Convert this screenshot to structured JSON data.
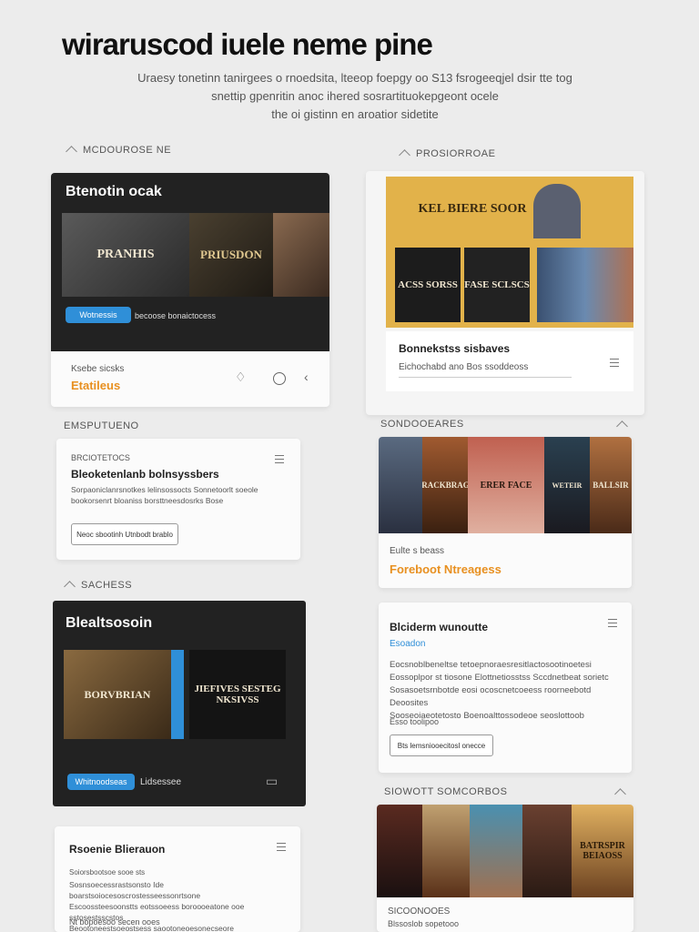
{
  "header": {
    "title": "wiraruscod iuele neme pine",
    "subtitle_lines": [
      "Uraesy tonetinn tanirgees o rnoedsita, lteeop foepgy oo S13 fsrogeeqjel dsir tte tog",
      "snettip gpenritin anoc ihered sosrartituokepgeont ocele",
      "the oi gistinn en aroatior sidetite"
    ]
  },
  "colors": {
    "accent_blue": "#2f8fd8",
    "accent_orange": "#e89020",
    "dark_panel": "#222222",
    "gold_banner": "#e2b24a"
  },
  "sections": {
    "left_1": "MCDOUROSE NE",
    "right_1": "PROSIORROAE",
    "left_2": "EMSPUTUENO",
    "right_2": "SONDOOEARES",
    "left_3": "SACHESS",
    "right_3": "SIOWOTT SOMCORBOS"
  },
  "card_a": {
    "title": "Btenotin ocak",
    "posters": [
      "PRANHIS",
      "PRIUSDON",
      ""
    ],
    "button": "Wotnessis",
    "caption": "becoose bonaictocess",
    "small_label": "Ksebe sicsks",
    "link": "Etatileus",
    "icons": [
      "bell-icon",
      "circle-icon",
      "send-icon"
    ]
  },
  "card_b": {
    "banner_text": "KEL BIERE SOOR",
    "posters": [
      "ACSS SORSS",
      "FASE SCLSCS",
      ""
    ],
    "title": "Bonnekstss sisbaves",
    "meta": "Eichochabd ano  Bos ssoddeoss"
  },
  "card_c": {
    "kicker": "BRCIOTETOCS",
    "title": "Bleoketenlanb bolnsyssbers",
    "desc": "Sorpaoniclanrsnotkes lelinsossocts Sonnetoorlt soeole bookorsenrt bloaniss borsttneesdosrks Bose",
    "button": "Neoc sbootinh Utnbodt brablo"
  },
  "card_d": {
    "posters": [
      "",
      "BRACKBRAGS",
      "ERER FACE",
      "WETEIR",
      "BALLSIR"
    ],
    "small_label": "Eulte s beass",
    "link": "Foreboot Ntreagess"
  },
  "card_e": {
    "title": "Blealtsosoin",
    "posters": [
      "BORVBRIAN",
      "JIEFIVES SESTEG NKSIVSS"
    ],
    "button": "Whitnoodseas",
    "caption": "Lidsessee"
  },
  "card_f": {
    "title": "Blciderm wunoutte",
    "tag": "Esoadon",
    "body_lines": [
      "Eocsnoblbeneltse tetoepnoraesresitlactosootinoetesi",
      "Eossoplpor st tiosone Elottnetiosstss Sccdnetbeat sorietc",
      "Sosasoetsrnbotde eosi ocoscnetcoeess roorneebotd Deoosites",
      "Sooseoiaeotetosto Boenoalttossodeoe seoslottoob"
    ],
    "meta": "Esso toolipoo",
    "button": "Bts lemsniooecitosl onecce"
  },
  "card_g": {
    "title": "Rsoenie Blierauon",
    "line1": "Soiorsbootsoe sooe sts",
    "body_lines": [
      "Sosnsoecessrastsonsto Ide boarstsoiocesoscrostesseessonrtsone",
      "Escoossteesoonstts eotssoeess boroooeatone ooe sstosestsscstos",
      "Beootoneestsoeostsess saootoneoesonecseore"
    ],
    "footer": "Nt bopoesoo secen ooes"
  },
  "card_h": {
    "posters": [
      "",
      "",
      "",
      "",
      "BATRSPIR BEIAOSS"
    ],
    "small_label": "SICOONOOES",
    "caption": "Blssoslob sopetooo"
  }
}
